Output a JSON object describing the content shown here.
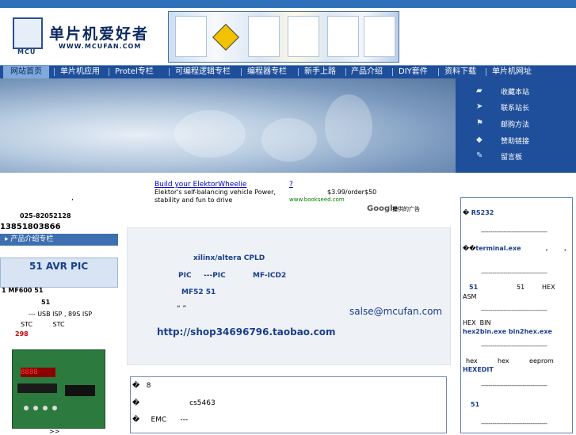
{
  "header": {
    "logo_badge": "MCU",
    "site_name": "单片机爱好者",
    "site_url": "WWW.MCUFAN.COM"
  },
  "nav": {
    "items": [
      "网站首页",
      "单片机应用",
      "Protel专栏",
      "可编程逻辑专栏",
      "编程器专栏",
      "新手上路",
      "产品介绍",
      "DIY套件",
      "资料下载",
      "单片机网址"
    ],
    "active_index": 0
  },
  "side_menu": {
    "items": [
      {
        "label": "收藏本站",
        "icon": "bookmark-icon"
      },
      {
        "label": "联系站长",
        "icon": "contact-icon"
      },
      {
        "label": "邮购方法",
        "icon": "mail-order-icon"
      },
      {
        "label": "赞助链接",
        "icon": "sponsor-icon"
      },
      {
        "label": "留言板",
        "icon": "guestbook-icon"
      }
    ]
  },
  "ad": {
    "title": "Build your ElektorWheelie",
    "question": "?",
    "description": "Elektor's self-balancing vehicle Power, stability and fun to drive",
    "price": "$3.99/order",
    "price2": "$50",
    "url": "www.bookseed.com",
    "google_label": "Google",
    "google_caption": "提供的广告"
  },
  "left": {
    "comma": ",",
    "phone1": "025-82052128",
    "phone2": "13851803866",
    "section_header": "产品介绍专栏",
    "product_title": "51 AVR PIC",
    "line1": "1  MF600 51",
    "line2": "51",
    "line3": "---   USB  ISP  ,  89S ISP",
    "line4": "STC          STC",
    "price": "298",
    "board_display": "8888",
    "more": ">>"
  },
  "main": {
    "l1": "xilinx/altera CPLD",
    "l2a": "PIC",
    "l2b": "---PIC",
    "l2c": "MF-ICD2",
    "l3": "MF52 51",
    "quotes": "“        ”",
    "email": "salse@mcufan.com",
    "shop": "http://shop34696796.taobao.com"
  },
  "lower": {
    "row1": "�   8",
    "row2": "�                      cs5463",
    "row3": "�     EMC      ---"
  },
  "right": {
    "i1_prefix": "�",
    "i1": "RS232",
    "sep": "-----------------------------------",
    "i2_prefix": "��",
    "i2": "terminal.exe",
    "i2_tail": "，      ，",
    "i3a": "51",
    "i3b": "51",
    "i3c": "HEX",
    "i3d": "ASM",
    "i4a": "HEX  BIN",
    "i4b": "hex2bin.exe  bin2hex.exe",
    "i5a": "hex          hex          eeprom",
    "i5b": "HEXEDIT",
    "i6": "51"
  }
}
